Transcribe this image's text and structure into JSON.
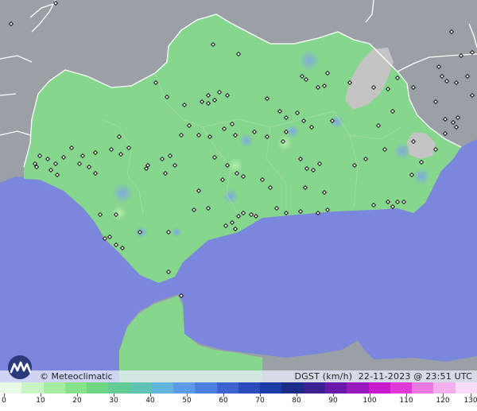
{
  "map": {
    "attribution": "© Meteoclimatic",
    "variable": "DGST (km/h)",
    "timestamp": "22-11-2023 @ 23:51 UTC"
  },
  "scale": {
    "labels": [
      "0",
      "10",
      "20",
      "30",
      "40",
      "50",
      "60",
      "70",
      "80",
      "90",
      "100",
      "110",
      "120",
      "130"
    ],
    "colors": [
      "#e9fbe6",
      "#c8f5c3",
      "#a6eda3",
      "#86e287",
      "#6fd784",
      "#63cc94",
      "#5fc2b4",
      "#63b4dc",
      "#5d9ae8",
      "#4d7fe0",
      "#3c63d0",
      "#2b4bbd",
      "#1b3ba6",
      "#1a2b8a",
      "#3a2090",
      "#6a1aa8",
      "#9a18c0",
      "#c81ccc",
      "#e03ad6",
      "#ea78e2",
      "#f2b0ee",
      "#f9dcf7"
    ]
  },
  "colors": {
    "sea": "#7b86dd",
    "land_andalusia": "#86d68d",
    "land_outside": "#9aa0a6",
    "high_terrain": "#c4c4c4",
    "border": "#ffffff"
  }
}
